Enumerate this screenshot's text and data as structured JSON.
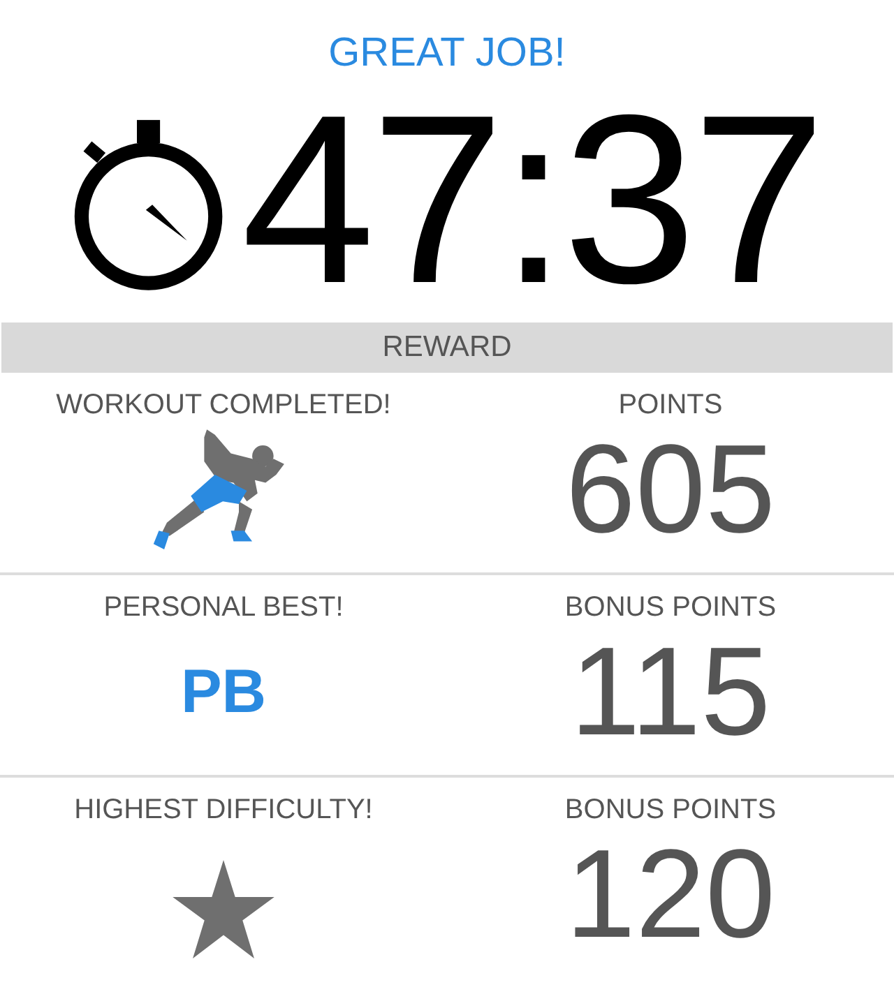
{
  "header": {
    "title": "GREAT JOB!",
    "time": "47:37"
  },
  "reward_bar": {
    "label": "REWARD"
  },
  "rows": [
    {
      "kind": "runner",
      "label": "WORKOUT COMPLETED!",
      "points_label": "POINTS",
      "points": "605"
    },
    {
      "kind": "badge",
      "label": "PERSONAL BEST!",
      "badge": "PB",
      "points_label": "BONUS POINTS",
      "points": "115"
    },
    {
      "kind": "star",
      "label": "HIGHEST DIFFICULTY!",
      "points_label": "BONUS POINTS",
      "points": "120"
    }
  ]
}
